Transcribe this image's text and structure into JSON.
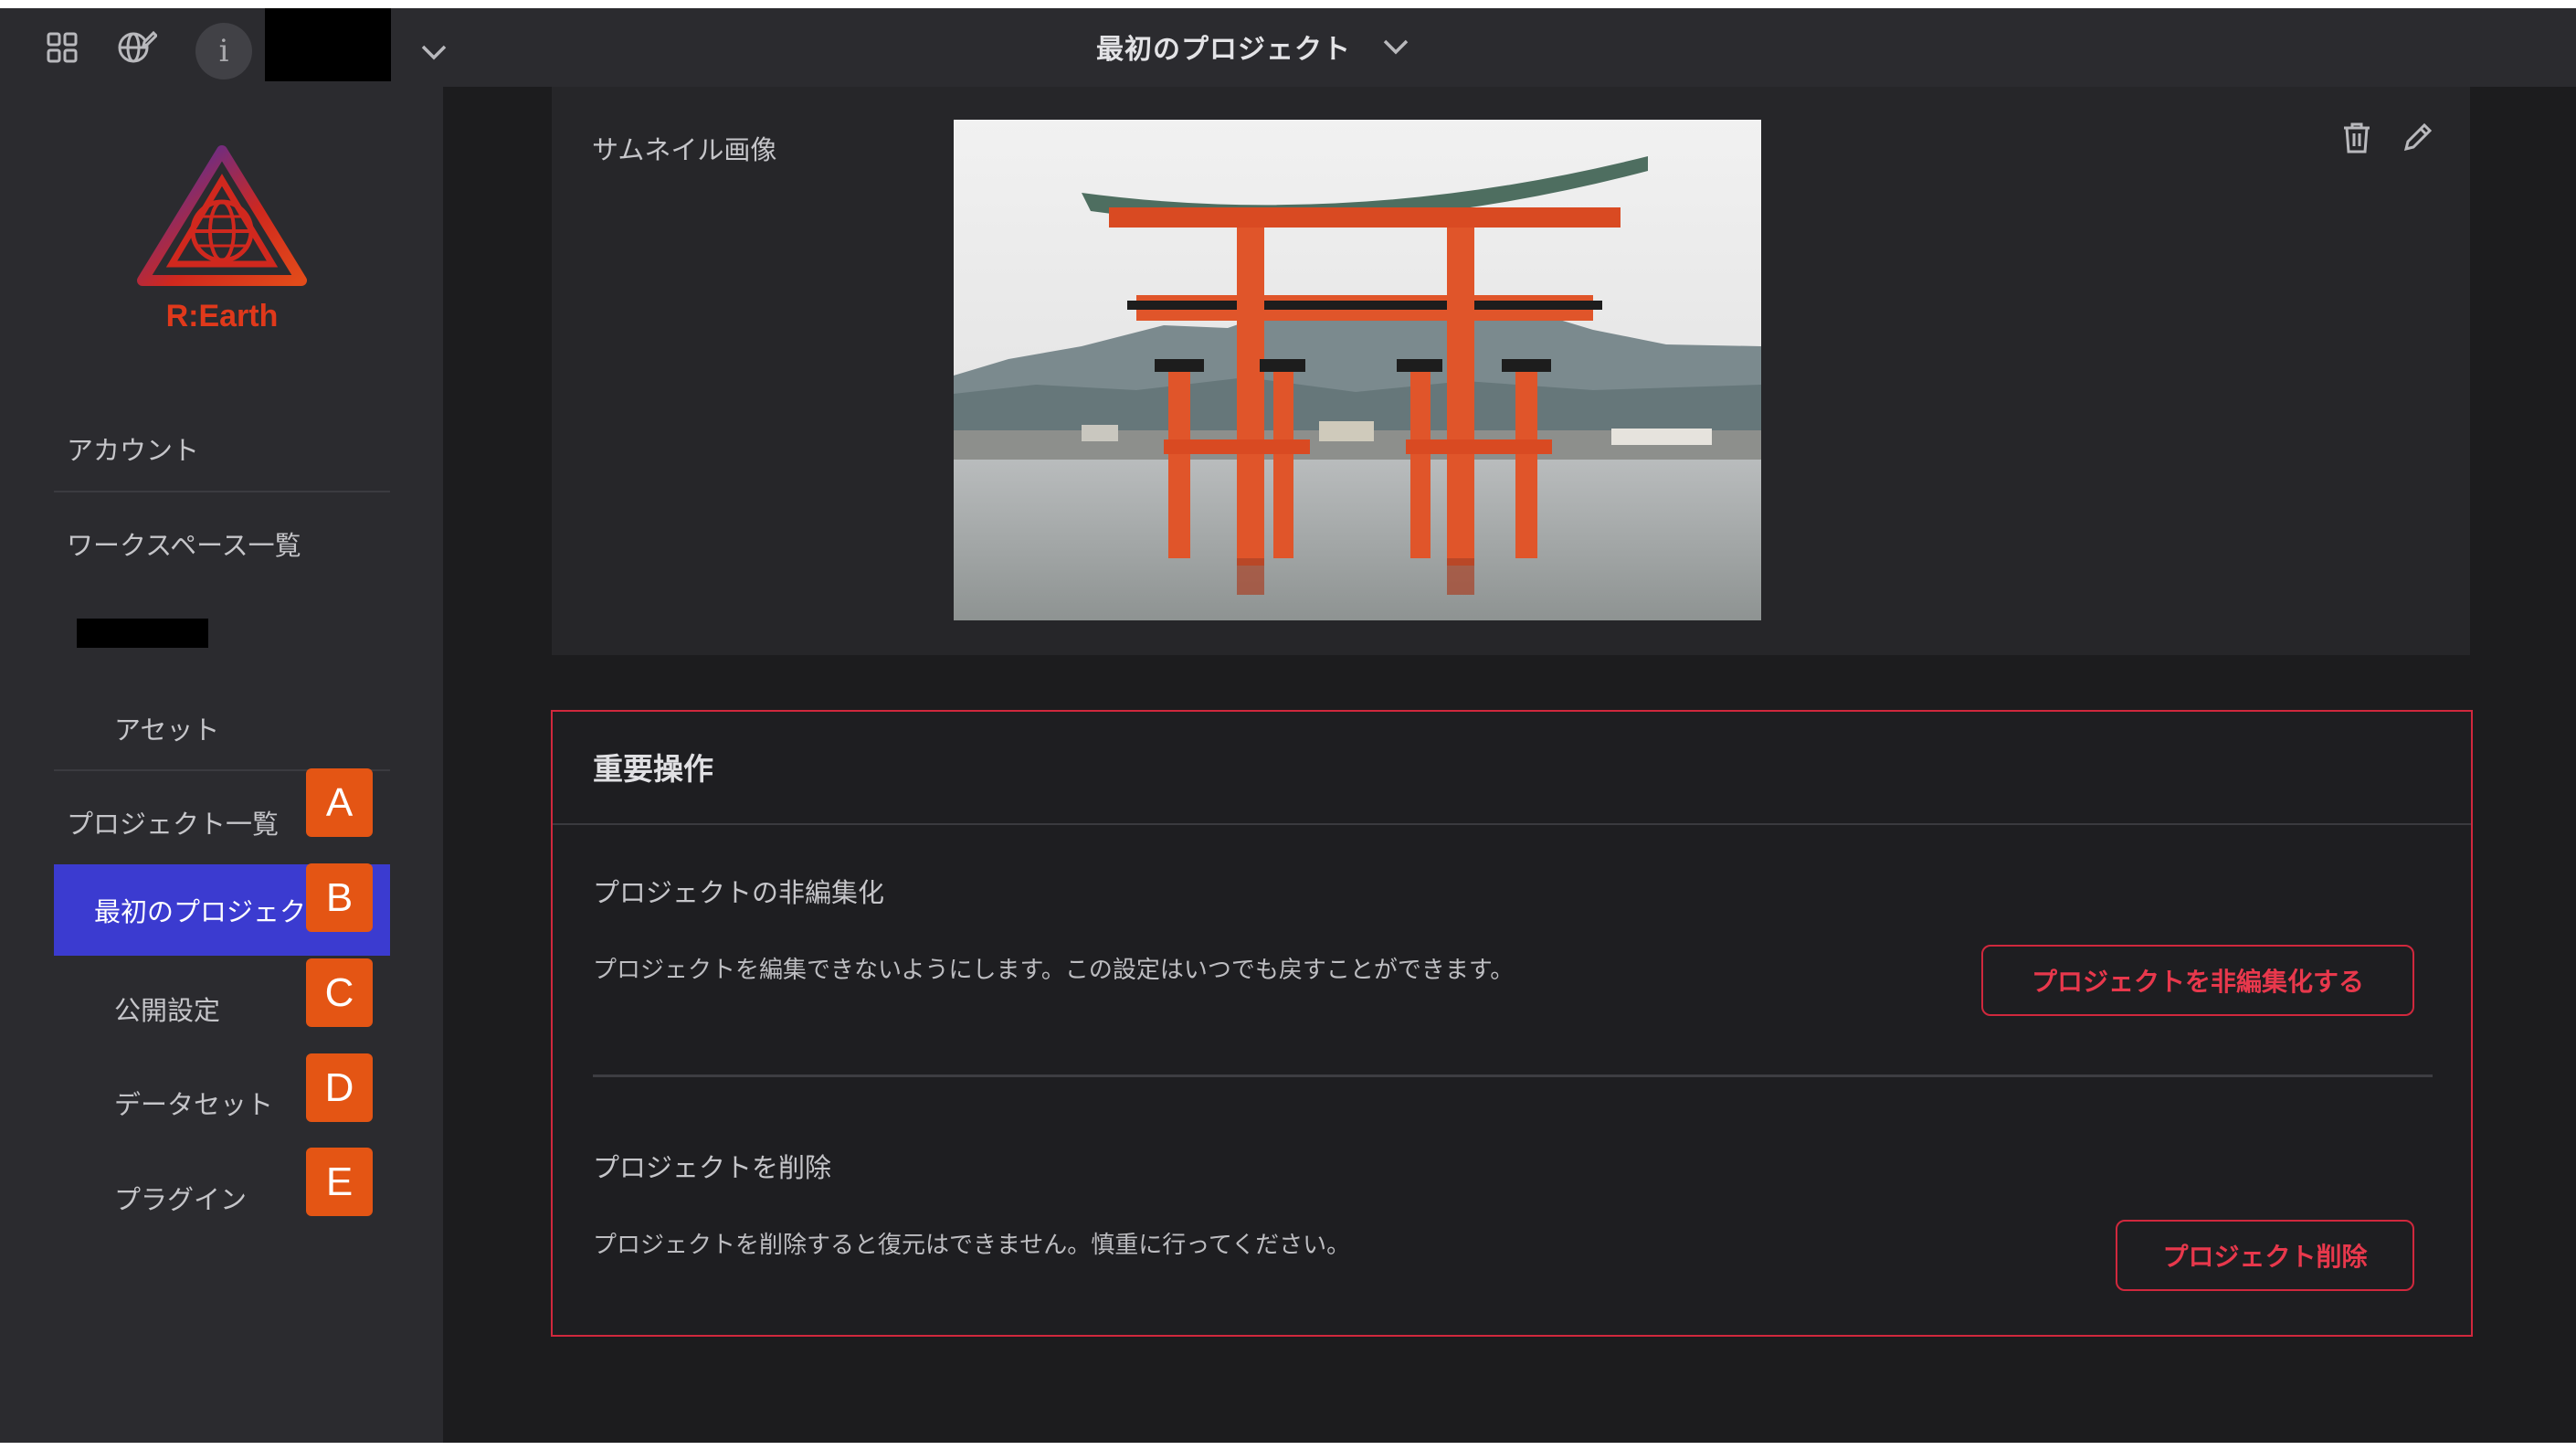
{
  "topbar": {
    "project_title": "最初のプロジェクト",
    "info_glyph": "i",
    "icons": [
      "apps-grid-icon",
      "globe-edit-icon",
      "info-icon",
      "chevron-down-icon"
    ]
  },
  "sidebar": {
    "logo_text": "R:Earth",
    "items": [
      {
        "label": "アカウント"
      },
      {
        "label": "ワークスペース一覧"
      },
      {
        "label": "アセット"
      },
      {
        "label": "プロジェクト一覧"
      },
      {
        "label": "最初のプロジェクト"
      },
      {
        "label": "公開設定"
      },
      {
        "label": "データセット"
      },
      {
        "label": "プラグイン"
      }
    ],
    "badges": [
      "A",
      "B",
      "C",
      "D",
      "E"
    ]
  },
  "thumbnail": {
    "label": "サムネイル画像"
  },
  "danger_zone": {
    "title": "重要操作",
    "unedit": {
      "title": "プロジェクトの非編集化",
      "description": "プロジェクトを編集できないようにします。この設定はいつでも戻すことができます。",
      "button": "プロジェクトを非編集化する"
    },
    "delete": {
      "title": "プロジェクトを削除",
      "description": "プロジェクトを削除すると復元はできません。慎重に行ってください。",
      "button": "プロジェクト削除"
    }
  },
  "colors": {
    "accent": "#3b3bd0",
    "danger": "#d0283d",
    "badge": "#e45514",
    "logo": "#e0391b"
  }
}
